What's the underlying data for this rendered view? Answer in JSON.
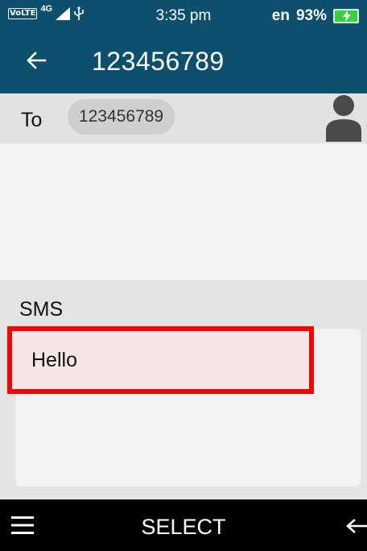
{
  "status_bar": {
    "volte": "VoLTE",
    "network": "4G",
    "time": "3:35 pm",
    "language": "en",
    "battery": "93%",
    "battery_color": "#36d13e"
  },
  "header": {
    "title": "123456789",
    "background": "#0e4f6e",
    "back_icon": "arrow-left-icon"
  },
  "recipient": {
    "to_label": "To",
    "chip": "123456789",
    "contact_icon": "person-icon"
  },
  "sms": {
    "label": "SMS",
    "message": "Hello",
    "highlight_color": "#ff0000"
  },
  "softkeys": {
    "left_icon": "menu-icon",
    "center": "SELECT",
    "right_icon": "back-arrow-icon"
  }
}
